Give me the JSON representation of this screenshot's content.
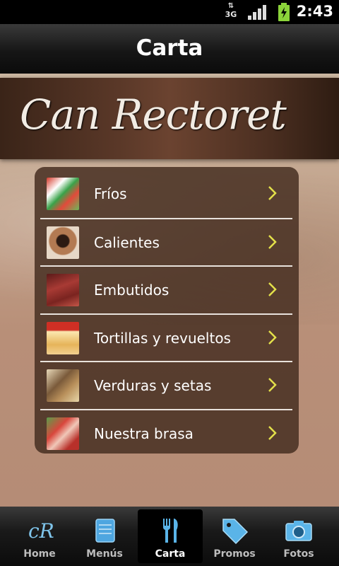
{
  "status_bar": {
    "network": "3G",
    "time": "2:43"
  },
  "header": {
    "title": "Carta"
  },
  "banner": {
    "logo_text": "Can Rectoret"
  },
  "menu": {
    "items": [
      {
        "label": "Fríos"
      },
      {
        "label": "Calientes"
      },
      {
        "label": "Embutidos"
      },
      {
        "label": "Tortillas y revueltos"
      },
      {
        "label": "Verduras y setas"
      },
      {
        "label": "Nuestra brasa"
      }
    ]
  },
  "tabs": [
    {
      "label": "Home",
      "icon": "logo-icon"
    },
    {
      "label": "Menús",
      "icon": "book-icon"
    },
    {
      "label": "Carta",
      "icon": "cutlery-icon",
      "active": true
    },
    {
      "label": "Promos",
      "icon": "tag-icon"
    },
    {
      "label": "Fotos",
      "icon": "camera-icon"
    }
  ],
  "colors": {
    "accent_chevron": "#e3e04a",
    "active_tab": "#000000",
    "icon_blue": "#5ab4e8"
  }
}
